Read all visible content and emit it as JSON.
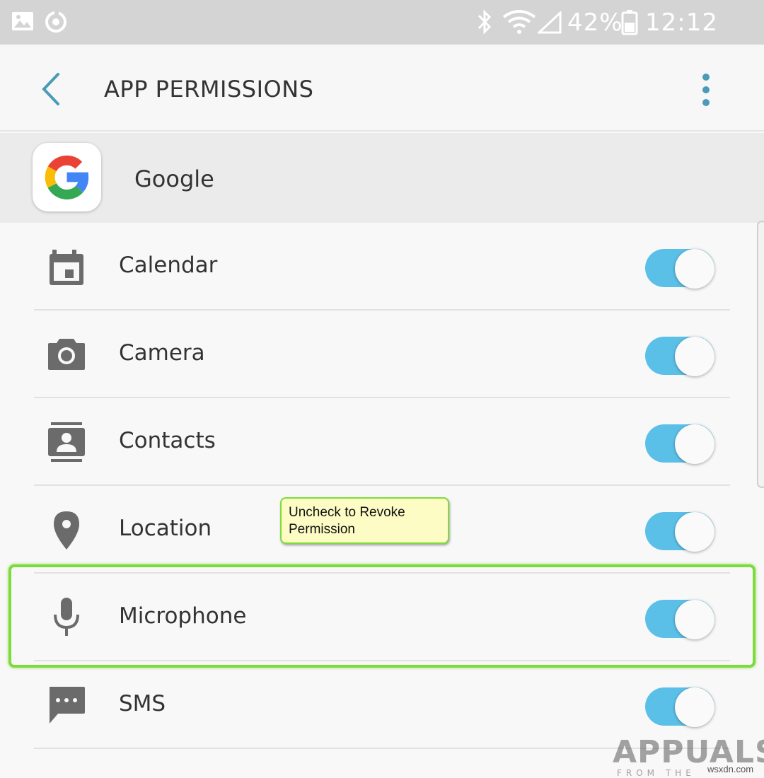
{
  "status_bar": {
    "battery": "42%",
    "time": "12:12 pm",
    "icons": [
      "image-icon",
      "sync-icon",
      "bluetooth-icon",
      "wifi-icon",
      "signal-icon",
      "battery-icon"
    ]
  },
  "app_bar": {
    "title": "APP PERMISSIONS",
    "back_icon": "chevron-left-icon",
    "more_icon": "more-vert-icon",
    "accent": "#4a9bb8"
  },
  "app": {
    "name": "Google",
    "icon": "google-logo-icon"
  },
  "permissions": [
    {
      "label": "Calendar",
      "icon": "calendar-icon",
      "enabled": true
    },
    {
      "label": "Camera",
      "icon": "camera-icon",
      "enabled": true
    },
    {
      "label": "Contacts",
      "icon": "contacts-icon",
      "enabled": true
    },
    {
      "label": "Location",
      "icon": "location-pin-icon",
      "enabled": true
    },
    {
      "label": "Microphone",
      "icon": "microphone-icon",
      "enabled": true
    },
    {
      "label": "SMS",
      "icon": "sms-icon",
      "enabled": true
    }
  ],
  "annotation": {
    "callout_text": "Uncheck to Revoke Permission",
    "highlight_color": "#7ddc3a",
    "callout_bg": "#fdfcc4"
  },
  "toggle_color": "#5bc0e8",
  "watermark": {
    "brand": "APPUALS",
    "tagline": "FROM THE EXPERTS!",
    "site": "wsxdn.com"
  }
}
